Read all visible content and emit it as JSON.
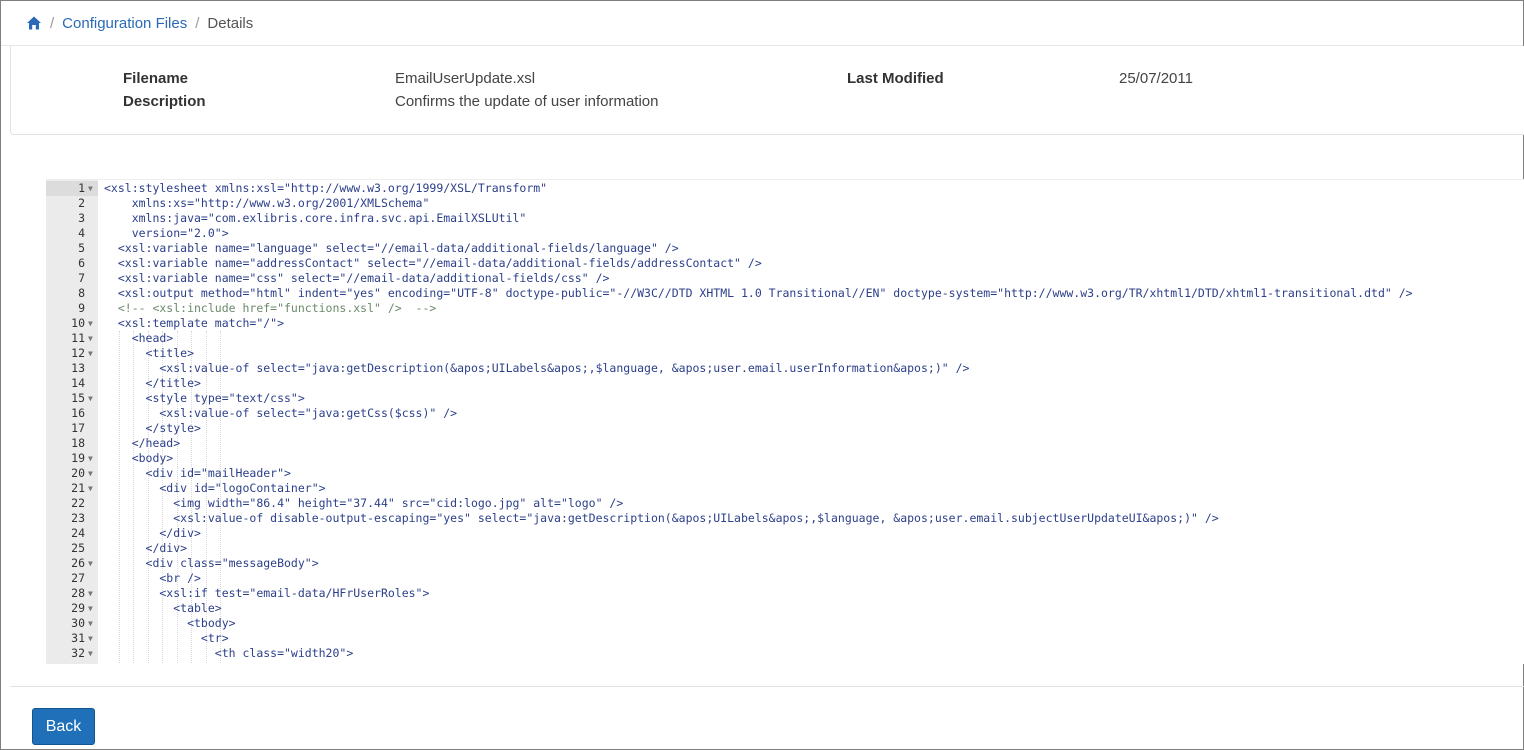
{
  "breadcrumb": {
    "home_icon": "home-icon",
    "items": [
      "Configuration Files",
      "Details"
    ],
    "separator": "/"
  },
  "details": {
    "filename_label": "Filename",
    "filename_value": "EmailUserUpdate.xsl",
    "description_label": "Description",
    "description_value": "Confirms the update of user information",
    "last_modified_label": "Last Modified",
    "last_modified_value": "25/07/2011"
  },
  "editor": {
    "active_line": 1,
    "lines": [
      {
        "n": "1",
        "fold": true,
        "text": "<xsl:stylesheet xmlns:xsl=\"http://www.w3.org/1999/XSL/Transform\""
      },
      {
        "n": "2",
        "fold": false,
        "text": "    xmlns:xs=\"http://www.w3.org/2001/XMLSchema\""
      },
      {
        "n": "3",
        "fold": false,
        "text": "    xmlns:java=\"com.exlibris.core.infra.svc.api.EmailXSLUtil\""
      },
      {
        "n": "4",
        "fold": false,
        "text": "    version=\"2.0\">"
      },
      {
        "n": "5",
        "fold": false,
        "text": "  <xsl:variable name=\"language\" select=\"//email-data/additional-fields/language\" />"
      },
      {
        "n": "6",
        "fold": false,
        "text": "  <xsl:variable name=\"addressContact\" select=\"//email-data/additional-fields/addressContact\" />"
      },
      {
        "n": "7",
        "fold": false,
        "text": "  <xsl:variable name=\"css\" select=\"//email-data/additional-fields/css\" />"
      },
      {
        "n": "8",
        "fold": false,
        "text": "  <xsl:output method=\"html\" indent=\"yes\" encoding=\"UTF-8\" doctype-public=\"-//W3C//DTD XHTML 1.0 Transitional//EN\" doctype-system=\"http://www.w3.org/TR/xhtml1/DTD/xhtml1-transitional.dtd\" />"
      },
      {
        "n": "9",
        "fold": false,
        "text": "  <!-- <xsl:include href=\"functions.xsl\" />  -->"
      },
      {
        "n": "10",
        "fold": true,
        "text": "  <xsl:template match=\"/\">"
      },
      {
        "n": "11",
        "fold": true,
        "text": "    <head>"
      },
      {
        "n": "12",
        "fold": true,
        "text": "      <title>"
      },
      {
        "n": "13",
        "fold": false,
        "text": "        <xsl:value-of select=\"java:getDescription(&apos;UILabels&apos;,$language, &apos;user.email.userInformation&apos;)\" />"
      },
      {
        "n": "14",
        "fold": false,
        "text": "      </title>"
      },
      {
        "n": "15",
        "fold": true,
        "text": "      <style type=\"text/css\">"
      },
      {
        "n": "16",
        "fold": false,
        "text": "        <xsl:value-of select=\"java:getCss($css)\" />"
      },
      {
        "n": "17",
        "fold": false,
        "text": "      </style>"
      },
      {
        "n": "18",
        "fold": false,
        "text": "    </head>"
      },
      {
        "n": "19",
        "fold": true,
        "text": "    <body>"
      },
      {
        "n": "20",
        "fold": true,
        "text": "      <div id=\"mailHeader\">"
      },
      {
        "n": "21",
        "fold": true,
        "text": "        <div id=\"logoContainer\">"
      },
      {
        "n": "22",
        "fold": false,
        "text": "          <img width=\"86.4\" height=\"37.44\" src=\"cid:logo.jpg\" alt=\"logo\" />"
      },
      {
        "n": "23",
        "fold": false,
        "text": "          <xsl:value-of disable-output-escaping=\"yes\" select=\"java:getDescription(&apos;UILabels&apos;,$language, &apos;user.email.subjectUserUpdateUI&apos;)\" />"
      },
      {
        "n": "24",
        "fold": false,
        "text": "        </div>"
      },
      {
        "n": "25",
        "fold": false,
        "text": "      </div>"
      },
      {
        "n": "26",
        "fold": true,
        "text": "      <div class=\"messageBody\">"
      },
      {
        "n": "27",
        "fold": false,
        "text": "        <br />"
      },
      {
        "n": "28",
        "fold": true,
        "text": "        <xsl:if test=\"email-data/HFrUserRoles\">"
      },
      {
        "n": "29",
        "fold": true,
        "text": "          <table>"
      },
      {
        "n": "30",
        "fold": true,
        "text": "            <tbody>"
      },
      {
        "n": "31",
        "fold": true,
        "text": "              <tr>"
      },
      {
        "n": "32",
        "fold": true,
        "text": "                <th class=\"width20\">"
      }
    ]
  },
  "footer": {
    "back_label": "Back"
  }
}
